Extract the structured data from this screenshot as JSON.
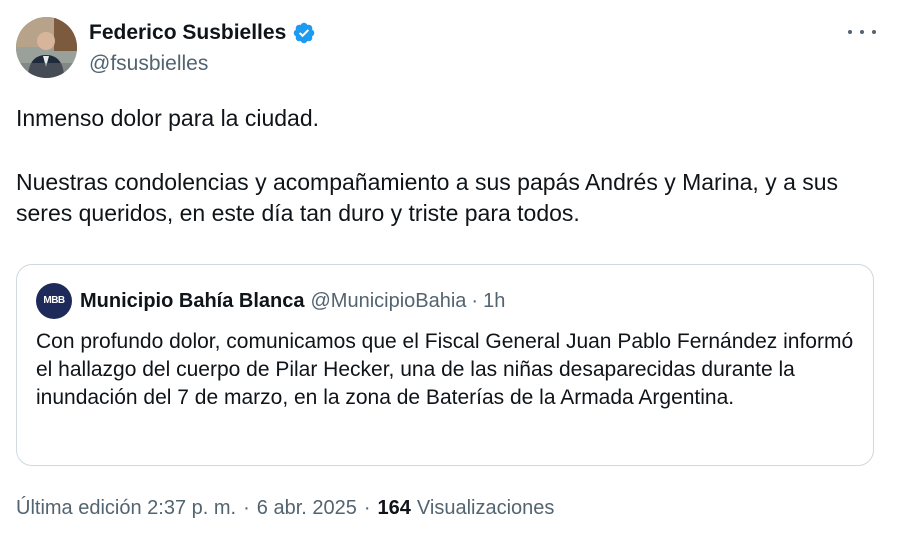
{
  "author": {
    "display_name": "Federico Susbielles",
    "handle": "@fsusbielles",
    "verified": true
  },
  "tweet": {
    "paragraphs": [
      "Inmenso dolor para la ciudad.",
      "Nuestras condolencias y acompañamiento a sus papás Andrés y Marina, y a sus seres queridos, en este día tan duro y triste para todos."
    ]
  },
  "quoted_tweet": {
    "avatar_text": "MBB",
    "display_name": "Municipio Bahía Blanca",
    "handle": "@MunicipioBahia",
    "separator": "·",
    "time": "1h",
    "text": "Con profundo dolor, comunicamos que el Fiscal General Juan Pablo Fernández informó el hallazgo del cuerpo de Pilar Hecker, una de las niñas desaparecidas durante la inundación del 7 de marzo, en la zona de Baterías de la Armada Argentina."
  },
  "meta": {
    "edited_time": "Última edición 2:37 p. m.",
    "separator": "·",
    "date": "6 abr. 2025",
    "views_count": "164",
    "views_label": "Visualizaciones"
  },
  "colors": {
    "verified": "#1d9bf0",
    "secondary_text": "#536471",
    "border": "#cfd9de"
  },
  "icons": {
    "verified": "verified-badge-icon",
    "more": "more-options-icon"
  }
}
